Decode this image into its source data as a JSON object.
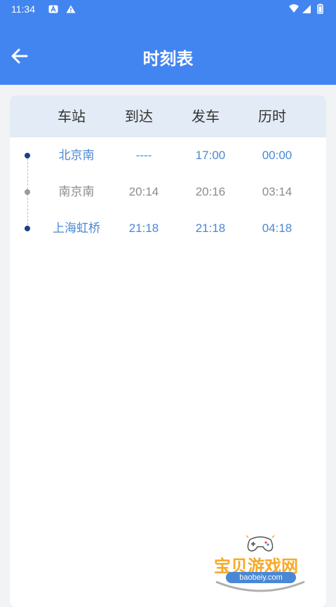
{
  "status_bar": {
    "time": "11:34",
    "icons_left": [
      "a-badge-icon",
      "warning-icon"
    ],
    "icons_right": [
      "wifi-icon",
      "signal-icon",
      "battery-icon"
    ]
  },
  "header": {
    "title": "时刻表",
    "back_icon": "arrow-left-icon"
  },
  "table": {
    "columns": [
      "车站",
      "到达",
      "发车",
      "历时"
    ],
    "rows": [
      {
        "station": "北京南",
        "arrive": "----",
        "depart": "17:00",
        "duration": "00:00",
        "style": "highlight"
      },
      {
        "station": "南京南",
        "arrive": "20:14",
        "depart": "20:16",
        "duration": "03:14",
        "style": "normal"
      },
      {
        "station": "上海虹桥",
        "arrive": "21:18",
        "depart": "21:18",
        "duration": "04:18",
        "style": "highlight"
      }
    ]
  },
  "watermark": {
    "title": "宝贝游戏网",
    "url": "baobeiy.com"
  },
  "colors": {
    "header_bg": "#4285f0",
    "table_header_bg": "#e3ebf6",
    "highlight_text": "#4a88d6",
    "normal_text": "#8c8c8c",
    "dot_highlight": "#1d3f8a",
    "dot_normal": "#9a9a9a"
  }
}
